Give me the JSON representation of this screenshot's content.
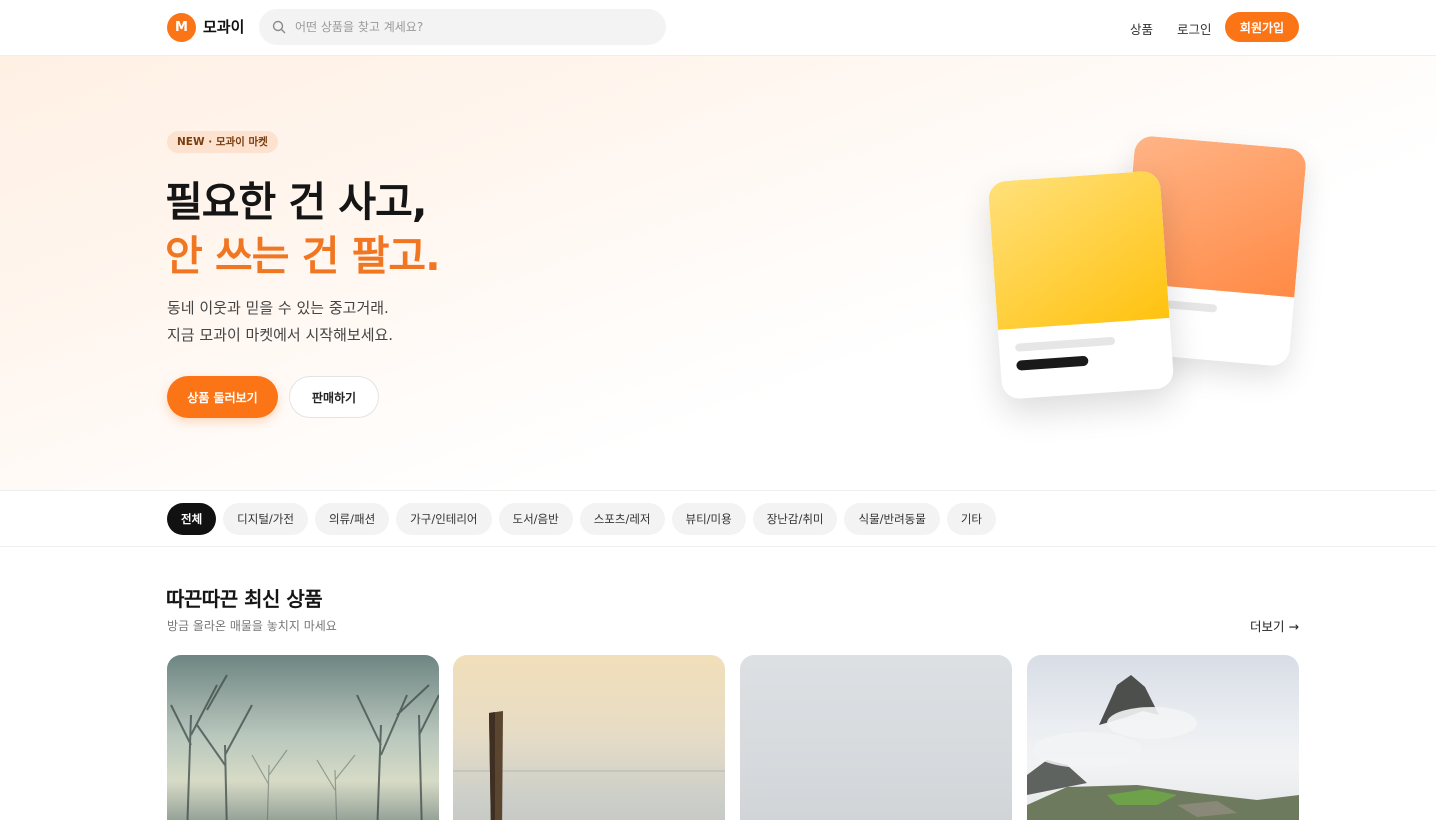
{
  "header": {
    "logo_letter": "M",
    "brand": "모과이",
    "search_placeholder": "어떤 상품을 찾고 계세요?",
    "nav": {
      "products": "상품",
      "login": "로그인",
      "signup": "회원가입"
    }
  },
  "hero": {
    "badge": "NEW · 모과이 마켓",
    "title_line1": "필요한 건 사고,",
    "title_line2": "안 쓰는 건 팔고.",
    "desc_line1": "동네 이웃과 믿을 수 있는 중고거래.",
    "desc_line2": "지금 모과이 마켓에서 시작해보세요.",
    "primary_cta": "상품 둘러보기",
    "secondary_cta": "판매하기"
  },
  "categories": [
    {
      "label": "전체",
      "active": true
    },
    {
      "label": "디지털/가전",
      "active": false
    },
    {
      "label": "의류/패션",
      "active": false
    },
    {
      "label": "가구/인테리어",
      "active": false
    },
    {
      "label": "도서/음반",
      "active": false
    },
    {
      "label": "스포츠/레저",
      "active": false
    },
    {
      "label": "뷰티/미용",
      "active": false
    },
    {
      "label": "장난감/취미",
      "active": false
    },
    {
      "label": "식물/반려동물",
      "active": false
    },
    {
      "label": "기타",
      "active": false
    }
  ],
  "latest": {
    "title": "따끈따끈 최신 상품",
    "subtitle": "방금 올라온 매물을 놓치지 마세요",
    "more": "더보기 →"
  },
  "colors": {
    "accent": "#fb7517",
    "title_accent": "#f17622",
    "chip_active": "#111111",
    "chip_bg": "#f3f3f3"
  }
}
